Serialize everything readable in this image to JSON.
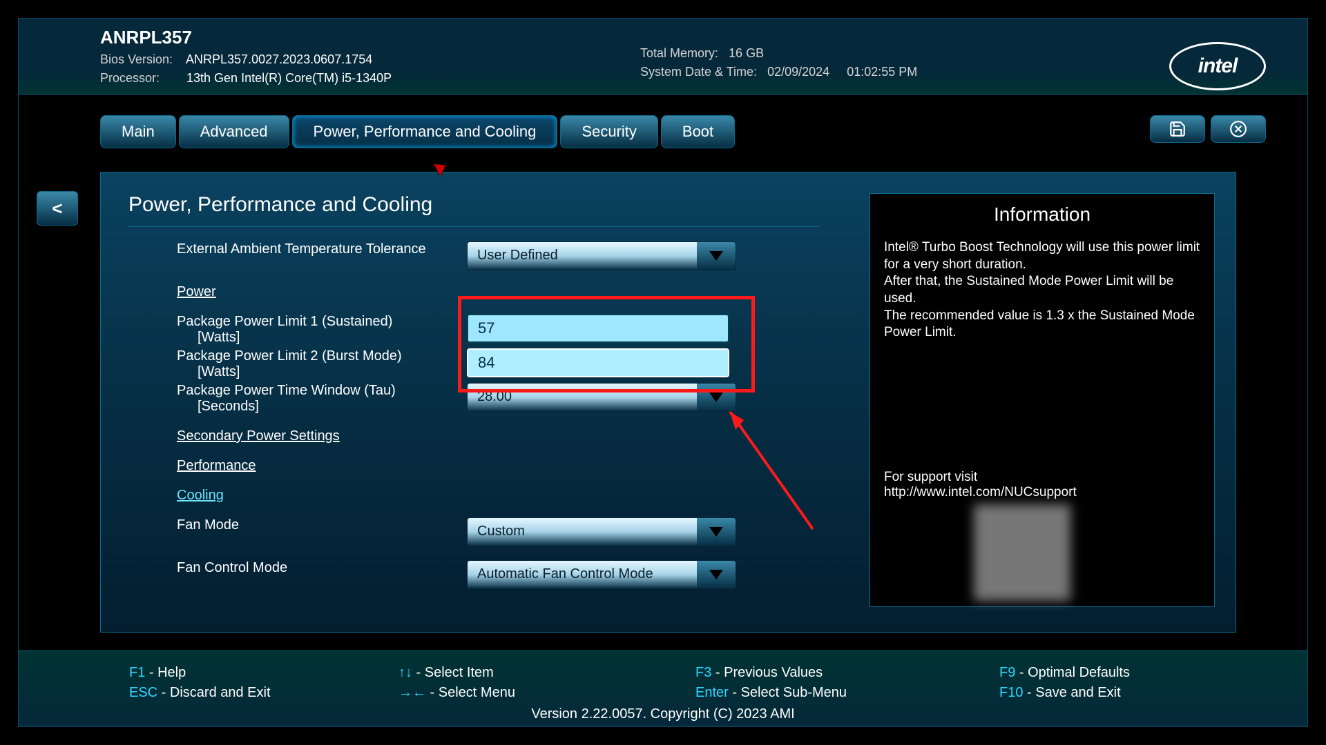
{
  "header": {
    "title": "ANRPL357",
    "bios_label": "Bios Version:",
    "bios_value": "ANRPL357.0027.2023.0607.1754",
    "proc_label": "Processor:",
    "proc_value": "13th Gen Intel(R) Core(TM) i5-1340P",
    "mem_label": "Total Memory:",
    "mem_value": "16 GB",
    "date_label": "System Date & Time:",
    "date_value": "02/09/2024",
    "time_value": "01:02:55 PM",
    "logo_text": "intel"
  },
  "tabs": {
    "t0": "Main",
    "t1": "Advanced",
    "t2": "Power, Performance and Cooling",
    "t3": "Security",
    "t4": "Boot"
  },
  "back_label": "<",
  "panel": {
    "title": "Power, Performance and Cooling",
    "ambient_label": "External Ambient Temperature Tolerance",
    "ambient_value": "User Defined",
    "power_link": "Power",
    "pl1_label": "Package Power Limit 1 (Sustained)",
    "pl1_sub": "[Watts]",
    "pl1_value": "57",
    "pl2_label": "Package Power Limit 2 (Burst Mode)",
    "pl2_sub": "[Watts]",
    "pl2_value": "84",
    "tau_label": "Package Power Time Window (Tau)",
    "tau_sub": "[Seconds]",
    "tau_value": "28.00",
    "secondary_link": "Secondary Power Settings",
    "performance_link": "Performance",
    "cooling_link": "Cooling",
    "fan_mode_label": "Fan Mode",
    "fan_mode_value": "Custom",
    "fan_ctrl_label": "Fan Control Mode",
    "fan_ctrl_value": "Automatic Fan Control Mode"
  },
  "info": {
    "title": "Information",
    "body": "Intel® Turbo Boost Technology will use this power limit for a very short duration.\nAfter that, the Sustained Mode Power Limit will be used.\nThe recommended value is 1.3 x the Sustained Mode Power Limit.",
    "support_label": "For support visit",
    "support_url": "http://www.intel.com/NUCsupport"
  },
  "footer": {
    "f1": "F1",
    "help": " - Help",
    "esc": "ESC",
    "discard": " - Discard and Exit",
    "arrows_ud": "↑↓",
    "select_item": " - Select Item",
    "arrows_lr": "→←",
    "select_menu": " - Select Menu",
    "f3": "F3",
    "prev": " - Previous Values",
    "enter": "Enter",
    "submenu": " - Select Sub-Menu",
    "f9": "F9",
    "optimal": " - Optimal Defaults",
    "f10": "F10",
    "save": " - Save and Exit",
    "version": "Version 2.22.0057. Copyright (C) 2023 AMI"
  }
}
